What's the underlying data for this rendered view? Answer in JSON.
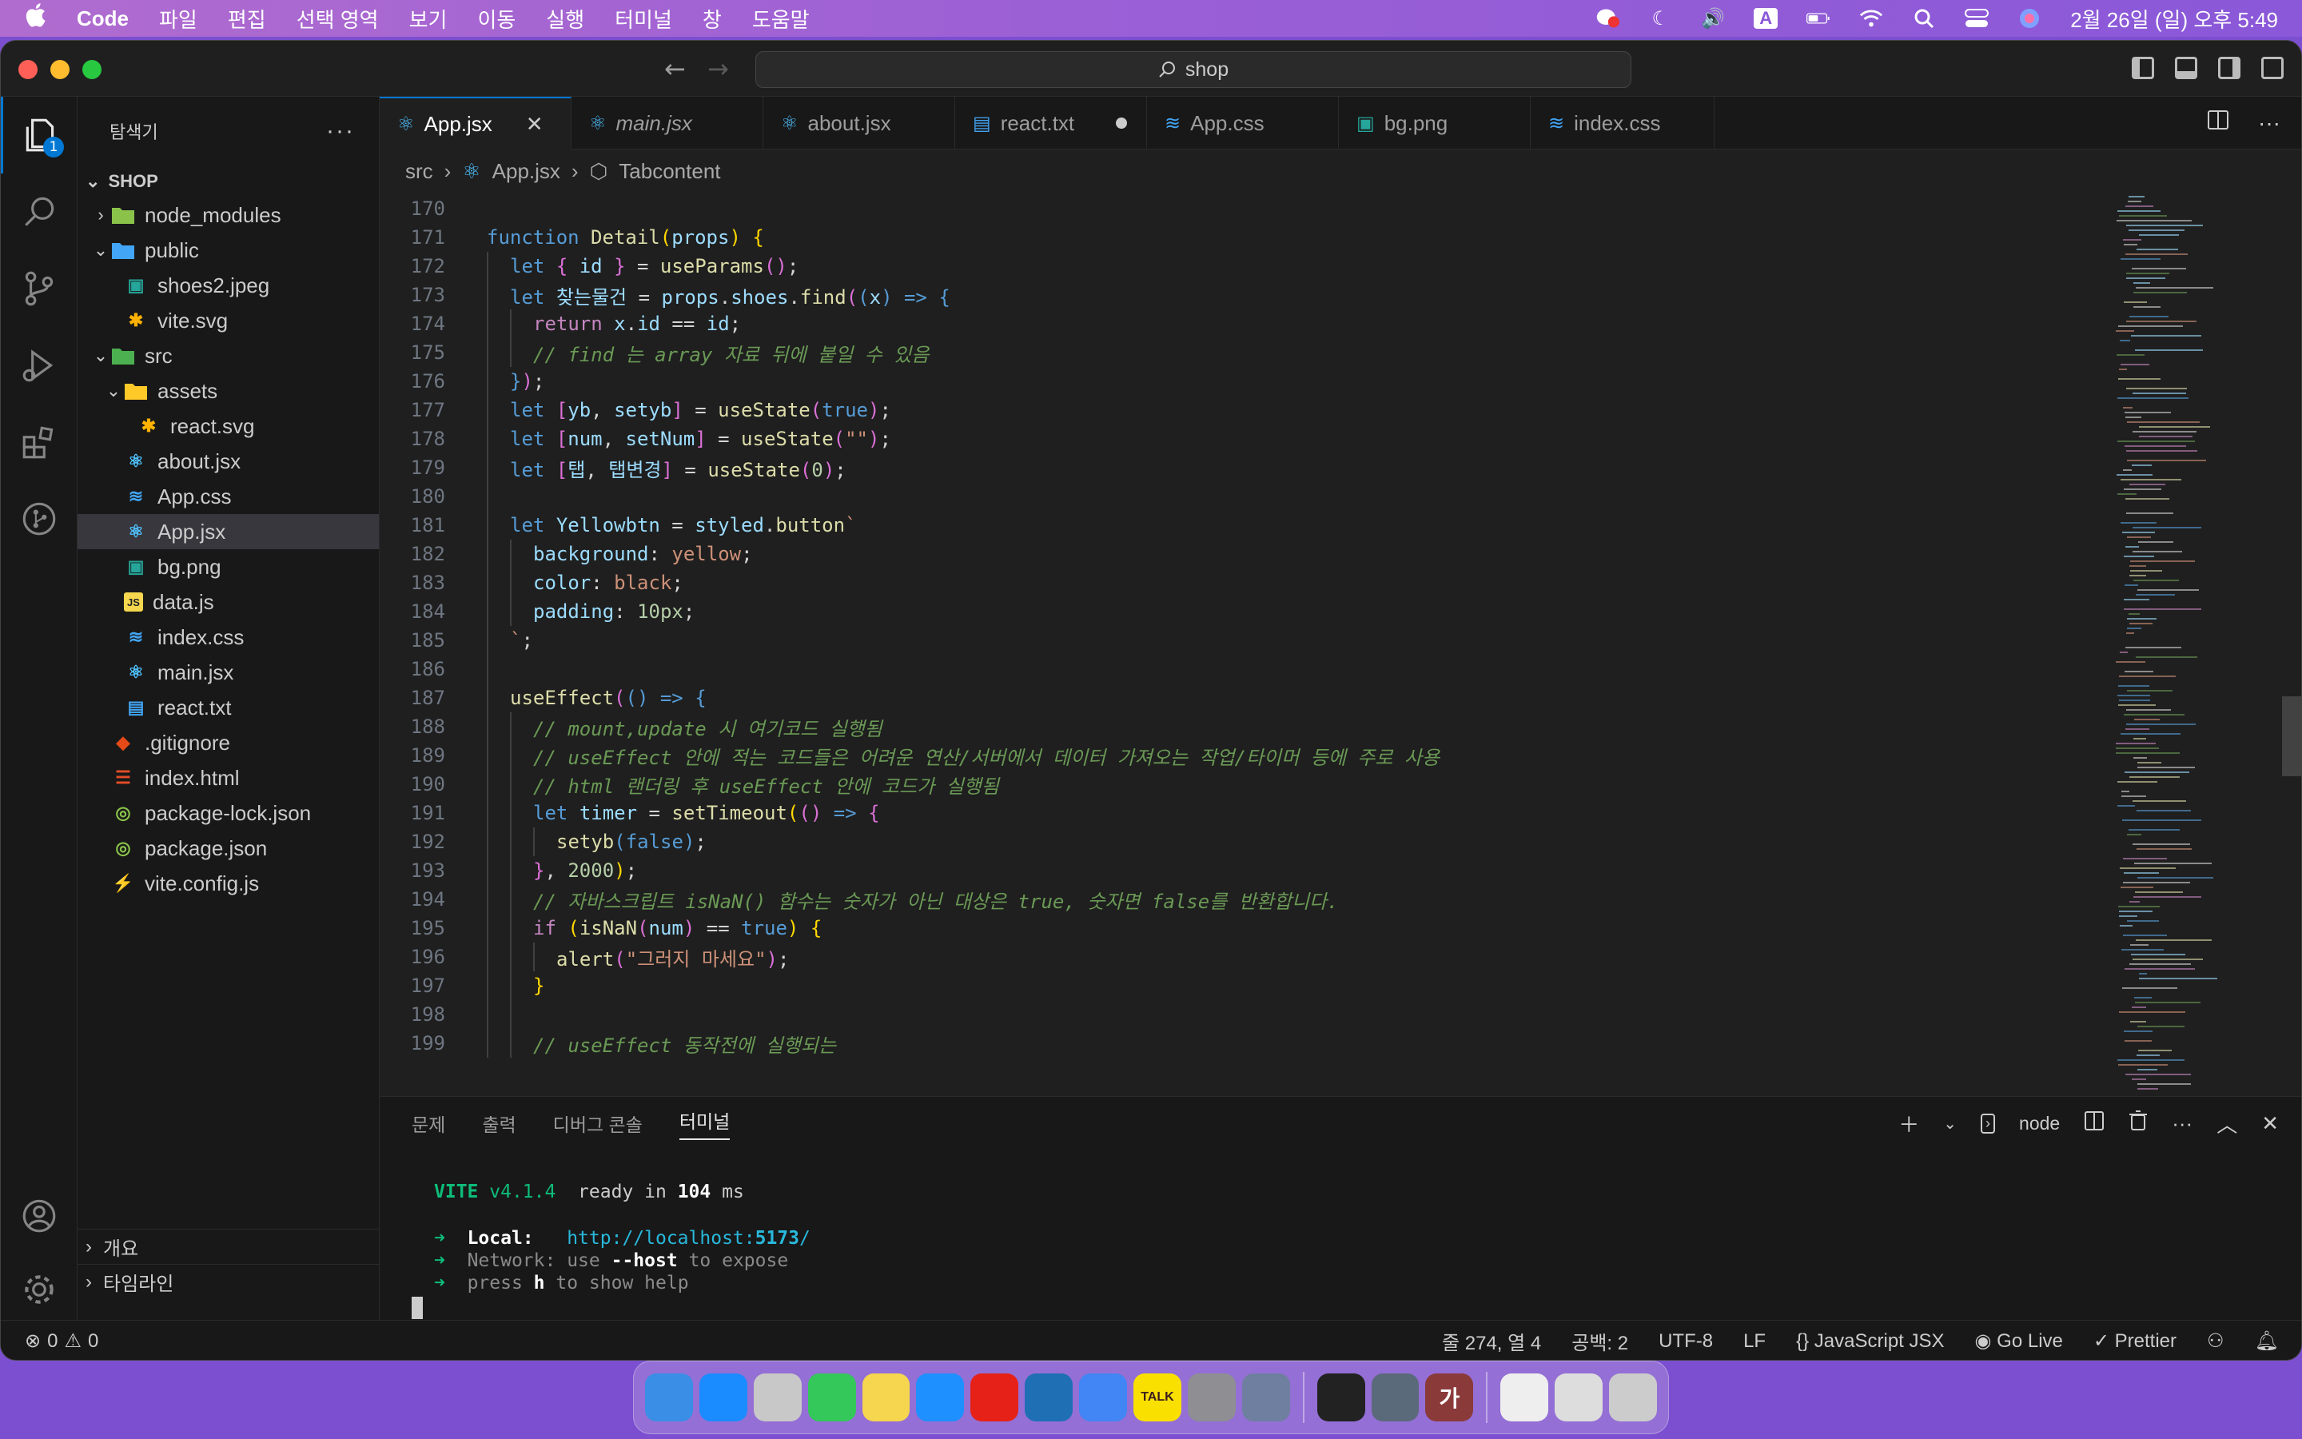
{
  "menubar": {
    "apple": "",
    "app": "Code",
    "items": [
      "파일",
      "편집",
      "선택 영역",
      "보기",
      "이동",
      "실행",
      "터미널",
      "창",
      "도움말"
    ],
    "input_indicator": "A",
    "clock": "2월 26일 (일) 오후 5:49"
  },
  "titlebar": {
    "search": "shop"
  },
  "activity": {
    "explorer_badge": "1"
  },
  "sidebar": {
    "title": "탐색기",
    "more": "···",
    "root": "SHOP",
    "items": [
      {
        "label": "node_modules",
        "depth": 1,
        "type": "folder",
        "open": false
      },
      {
        "label": "public",
        "depth": 1,
        "type": "folder",
        "open": true
      },
      {
        "label": "shoes2.jpeg",
        "depth": 2,
        "type": "image"
      },
      {
        "label": "vite.svg",
        "depth": 2,
        "type": "svg"
      },
      {
        "label": "src",
        "depth": 1,
        "type": "folder",
        "open": true
      },
      {
        "label": "assets",
        "depth": 2,
        "type": "folder",
        "open": true
      },
      {
        "label": "react.svg",
        "depth": 3,
        "type": "svg"
      },
      {
        "label": "about.jsx",
        "depth": 2,
        "type": "react"
      },
      {
        "label": "App.css",
        "depth": 2,
        "type": "css"
      },
      {
        "label": "App.jsx",
        "depth": 2,
        "type": "react",
        "selected": true
      },
      {
        "label": "bg.png",
        "depth": 2,
        "type": "image"
      },
      {
        "label": "data.js",
        "depth": 2,
        "type": "js"
      },
      {
        "label": "index.css",
        "depth": 2,
        "type": "css"
      },
      {
        "label": "main.jsx",
        "depth": 2,
        "type": "react"
      },
      {
        "label": "react.txt",
        "depth": 2,
        "type": "txt"
      },
      {
        "label": ".gitignore",
        "depth": 1,
        "type": "git"
      },
      {
        "label": "index.html",
        "depth": 1,
        "type": "html"
      },
      {
        "label": "package-lock.json",
        "depth": 1,
        "type": "json"
      },
      {
        "label": "package.json",
        "depth": 1,
        "type": "json"
      },
      {
        "label": "vite.config.js",
        "depth": 1,
        "type": "vite"
      }
    ],
    "outline": "개요",
    "timeline": "타임라인"
  },
  "tabs": [
    {
      "label": "App.jsx",
      "type": "react",
      "active": true,
      "close": "✕"
    },
    {
      "label": "main.jsx",
      "type": "react",
      "italic": true
    },
    {
      "label": "about.jsx",
      "type": "react"
    },
    {
      "label": "react.txt",
      "type": "txt",
      "modified": true
    },
    {
      "label": "App.css",
      "type": "css"
    },
    {
      "label": "bg.png",
      "type": "image"
    },
    {
      "label": "index.css",
      "type": "css"
    }
  ],
  "breadcrumb": [
    "src",
    "App.jsx",
    "Tabcontent"
  ],
  "editor": {
    "lines": [
      {
        "n": "170",
        "indent": 0,
        "html": ""
      },
      {
        "n": "171",
        "indent": 0,
        "html": "<span class='k'>function</span> <span class='f'>Detail</span><span class='p'>(</span><span class='v'>props</span><span class='p'>)</span> <span class='p'>{</span>"
      },
      {
        "n": "172",
        "indent": 1,
        "html": "<span class='k'>let</span> <span class='pp'>{</span> <span class='v'>id</span> <span class='pp'>}</span> = <span class='f'>useParams</span><span class='pp'>()</span>;"
      },
      {
        "n": "173",
        "indent": 1,
        "html": "<span class='k'>let</span> <span class='v'>찾는물건</span> = <span class='v'>props</span>.<span class='v'>shoes</span>.<span class='f'>find</span><span class='pp'>(</span><span class='k'>(</span><span class='v'>x</span><span class='k'>)</span> <span class='k'>=&gt;</span> <span class='k'>{</span>"
      },
      {
        "n": "174",
        "indent": 2,
        "html": "<span class='ctl'>return</span> <span class='v'>x</span>.<span class='v'>id</span> == <span class='v'>id</span>;"
      },
      {
        "n": "175",
        "indent": 2,
        "html": "<span class='c'>// find 는 array 자료 뒤에 붙일 수 있음</span>"
      },
      {
        "n": "176",
        "indent": 1,
        "html": "<span class='k'>}</span><span class='pp'>)</span>;"
      },
      {
        "n": "177",
        "indent": 1,
        "html": "<span class='k'>let</span> <span class='pp'>[</span><span class='v'>yb</span>, <span class='v'>setyb</span><span class='pp'>]</span> = <span class='f'>useState</span><span class='pp'>(</span><span class='k'>true</span><span class='pp'>)</span>;"
      },
      {
        "n": "178",
        "indent": 1,
        "html": "<span class='k'>let</span> <span class='pp'>[</span><span class='v'>num</span>, <span class='v'>setNum</span><span class='pp'>]</span> = <span class='f'>useState</span><span class='pp'>(</span><span class='s'>\"\"</span><span class='pp'>)</span>;"
      },
      {
        "n": "179",
        "indent": 1,
        "html": "<span class='k'>let</span> <span class='pp'>[</span><span class='v'>탭</span>, <span class='v'>탭변경</span><span class='pp'>]</span> = <span class='f'>useState</span><span class='pp'>(</span><span class='n'>0</span><span class='pp'>)</span>;"
      },
      {
        "n": "180",
        "indent": 1,
        "html": ""
      },
      {
        "n": "181",
        "indent": 1,
        "html": "<span class='k'>let</span> <span class='v'>Yellowbtn</span> = <span class='v'>styled</span>.<span class='f'>button</span><span class='s'>`</span>"
      },
      {
        "n": "182",
        "indent": 2,
        "html": "<span class='v'>background</span>: <span class='s'>yellow</span>;"
      },
      {
        "n": "183",
        "indent": 2,
        "html": "<span class='v'>color</span>: <span class='s'>black</span>;"
      },
      {
        "n": "184",
        "indent": 2,
        "html": "<span class='v'>padding</span>: <span class='n'>10px</span>;"
      },
      {
        "n": "185",
        "indent": 1,
        "html": "<span class='s'>`</span>;"
      },
      {
        "n": "186",
        "indent": 1,
        "html": ""
      },
      {
        "n": "187",
        "indent": 1,
        "html": "<span class='f'>useEffect</span><span class='pp'>(</span><span class='k'>()</span> <span class='k'>=&gt;</span> <span class='k'>{</span>"
      },
      {
        "n": "188",
        "indent": 2,
        "html": "<span class='c'>// mount,update 시 여기코드 실행됨</span>"
      },
      {
        "n": "189",
        "indent": 2,
        "html": "<span class='c'>// useEffect 안에 적는 코드들은 어려운 연산/서버에서 데이터 가져오는 작업/타이머 등에 주로 사용</span>"
      },
      {
        "n": "190",
        "indent": 2,
        "html": "<span class='c'>// html 랜더링 후 useEffect 안에 코드가 실행됨</span>"
      },
      {
        "n": "191",
        "indent": 2,
        "html": "<span class='k'>let</span> <span class='v'>timer</span> = <span class='f'>setTimeout</span><span class='p'>(</span><span class='pp'>()</span> <span class='k'>=&gt;</span> <span class='pp'>{</span>"
      },
      {
        "n": "192",
        "indent": 3,
        "html": "<span class='f'>setyb</span><span class='k'>(</span><span class='k'>false</span><span class='k'>)</span>;"
      },
      {
        "n": "193",
        "indent": 2,
        "html": "<span class='pp'>}</span>, <span class='n'>2000</span><span class='p'>)</span>;"
      },
      {
        "n": "194",
        "indent": 2,
        "html": "<span class='c'>// 자바스크립트 isNaN() 함수는 숫자가 아닌 대상은 true, 숫자면 false를 반환합니다.</span>"
      },
      {
        "n": "195",
        "indent": 2,
        "html": "<span class='ctl'>if</span> <span class='p'>(</span><span class='f'>isNaN</span><span class='pp'>(</span><span class='v'>num</span><span class='pp'>)</span> == <span class='k'>true</span><span class='p'>)</span> <span class='p'>{</span>"
      },
      {
        "n": "196",
        "indent": 3,
        "html": "<span class='f'>alert</span><span class='pp'>(</span><span class='s'>\"그러지 마세요\"</span><span class='pp'>)</span>;"
      },
      {
        "n": "197",
        "indent": 2,
        "html": "<span class='p'>}</span>"
      },
      {
        "n": "198",
        "indent": 2,
        "html": ""
      },
      {
        "n": "199",
        "indent": 2,
        "html": "<span class='c'>// useEffect 동작전에 실행되는</span>"
      }
    ]
  },
  "panel": {
    "tabs": [
      "문제",
      "출력",
      "디버그 콘솔",
      "터미널"
    ],
    "active_tab": "터미널",
    "terminal_name": "node",
    "terminal": {
      "vite": "VITE",
      "version": "v4.1.4",
      "ready": "ready in",
      "ms": "104",
      "ms_unit": "ms",
      "local_label": "Local:",
      "local_url_a": "http://localhost:",
      "local_url_b": "5173",
      "local_url_c": "/",
      "network_label": "Network:",
      "network_a": "use",
      "network_b": "--host",
      "network_c": "to expose",
      "help_a": "press",
      "help_b": "h",
      "help_c": "to show help"
    }
  },
  "statusbar": {
    "errors": "0",
    "warnings": "0",
    "position": "줄 274, 열 4",
    "spaces": "공백: 2",
    "encoding": "UTF-8",
    "eol": "LF",
    "language": "JavaScript JSX",
    "golive": "Go Live",
    "prettier": "Prettier"
  },
  "dock": {
    "items": [
      {
        "name": "finder",
        "color": "#3a8ee6"
      },
      {
        "name": "app-store",
        "color": "#1a8cff"
      },
      {
        "name": "launchpad",
        "color": "#c8c8c8"
      },
      {
        "name": "facetime",
        "color": "#34c759"
      },
      {
        "name": "notes",
        "color": "#f5d64e"
      },
      {
        "name": "safari",
        "color": "#1e90ff"
      },
      {
        "name": "youtube",
        "color": "#e62117"
      },
      {
        "name": "vscode",
        "color": "#1f6fb5"
      },
      {
        "name": "chrome",
        "color": "#4285f4"
      },
      {
        "name": "kakaotalk",
        "color": "#f9e000",
        "label": "TALK"
      },
      {
        "name": "system-settings",
        "color": "#8e8e93"
      },
      {
        "name": "migration-assistant",
        "color": "#6e7fa0"
      },
      {
        "name": "terminal",
        "color": "#222"
      },
      {
        "name": "quicktime",
        "color": "#5a6a7a"
      },
      {
        "name": "dictionary",
        "color": "#8b3a3a",
        "label": "가"
      },
      {
        "name": "downloads-stack",
        "color": "#eee"
      },
      {
        "name": "recent-window",
        "color": "#ddd"
      },
      {
        "name": "trash",
        "color": "#ccc"
      }
    ]
  },
  "colors": {
    "accent": "#0078d4",
    "editor_bg": "#1f1f1f",
    "sidebar_bg": "#181818"
  }
}
